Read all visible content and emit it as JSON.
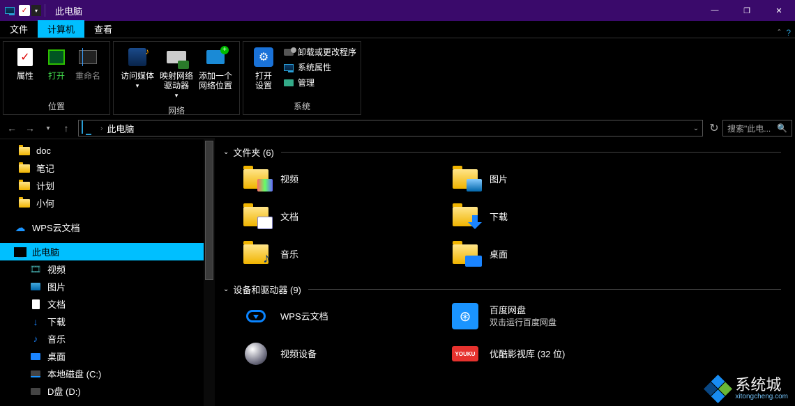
{
  "window": {
    "title": "此电脑",
    "min": "—",
    "max": "❐",
    "close": "✕"
  },
  "tabs": {
    "file": "文件",
    "computer": "计算机",
    "view": "查看"
  },
  "ribbon": {
    "loc": {
      "label": "位置",
      "props": "属性",
      "open": "打开",
      "rename": "重命名"
    },
    "net": {
      "label": "网络",
      "media": "访问媒体",
      "mapdrv": "映射网络\n驱动器",
      "addloc": "添加一个\n网络位置"
    },
    "sys": {
      "label": "系统",
      "settings": "打开\n设置",
      "uninstall": "卸载或更改程序",
      "sysprops": "系统属性",
      "manage": "管理"
    }
  },
  "nav": {
    "crumb": "此电脑",
    "search_placeholder": "搜索\"此电...",
    "refresh": "↻",
    "back": "←",
    "forward": "→",
    "up": "↑"
  },
  "tree": {
    "doc": "doc",
    "notes": "笔记",
    "plan": "计划",
    "xiaohe": "小何",
    "wps": "WPS云文档",
    "thispc": "此电脑",
    "video": "视频",
    "pictures": "图片",
    "documents": "文档",
    "downloads": "下载",
    "music": "音乐",
    "desktop": "桌面",
    "cdrive": "本地磁盘 (C:)",
    "ddrive": "D盘 (D:)"
  },
  "main": {
    "folders_header": "文件夹 (6)",
    "devices_header": "设备和驱动器 (9)",
    "folders": {
      "video": "视频",
      "pictures": "图片",
      "documents": "文档",
      "downloads": "下载",
      "music": "音乐",
      "desktop": "桌面"
    },
    "devices": {
      "wps": "WPS云文档",
      "baidu": "百度网盘",
      "baidu_sub": "双击运行百度网盘",
      "videodev": "视频设备",
      "youku": "优酷影视库 (32 位)",
      "youku_icon_text": "YOUKU"
    }
  },
  "watermark": {
    "name": "系统城",
    "url": "xitongcheng.com"
  }
}
